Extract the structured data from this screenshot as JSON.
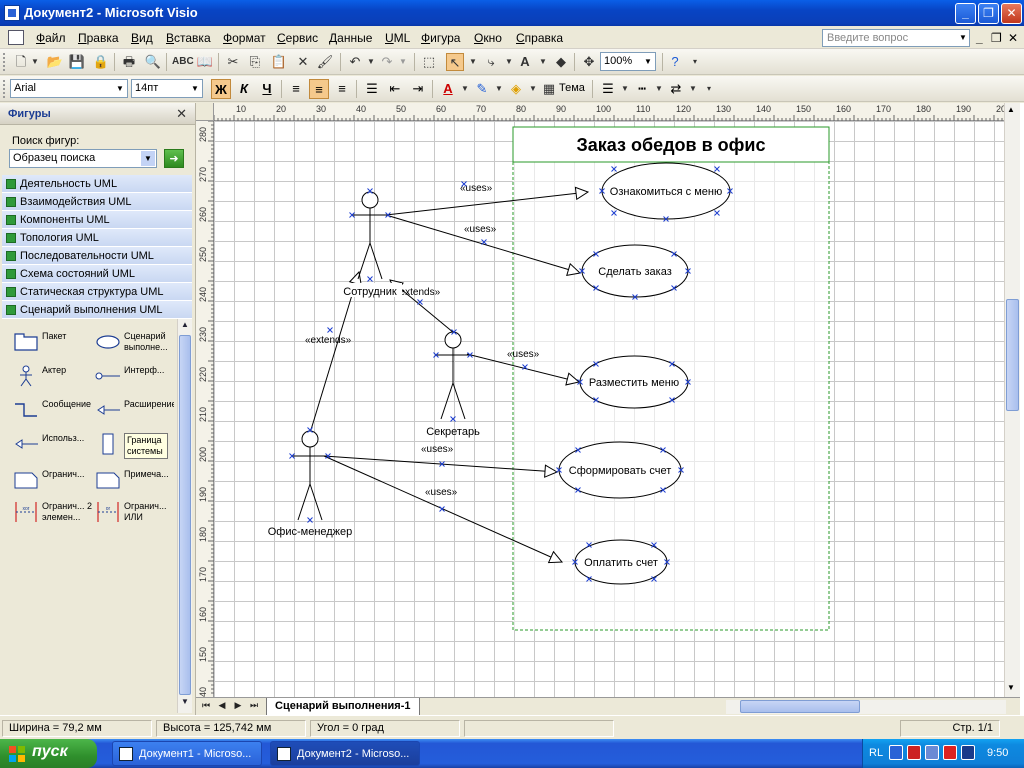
{
  "window": {
    "title": "Документ2 - Microsoft Visio",
    "minimize": "_",
    "maximize": "❐",
    "close": "✕"
  },
  "menu": {
    "items": [
      "Файл",
      "Правка",
      "Вид",
      "Вставка",
      "Формат",
      "Сервис",
      "Данные",
      "UML",
      "Фигура",
      "Окно",
      "Справка"
    ],
    "help_placeholder": "Введите вопрос",
    "mdi_minimize": "_",
    "mdi_restore": "❐",
    "mdi_close": "✕"
  },
  "standard_toolbar": {
    "zoom": "100%"
  },
  "format_toolbar": {
    "font": "Arial",
    "size": "14пт",
    "bold": "Ж",
    "italic": "К",
    "underline": "Ч",
    "theme": "Тема"
  },
  "shapes_pane": {
    "title": "Фигуры",
    "close": "✕",
    "search_label": "Поиск фигур:",
    "search_placeholder": "Образец поиска",
    "search_go": "➜",
    "stencils": [
      "Деятельность UML",
      "Взаимодействия UML",
      "Компоненты UML",
      "Топология UML",
      "Последовательности UML",
      "Схема состояний UML",
      "Статическая структура UML",
      "Сценарий выполнения UML"
    ],
    "masters": [
      {
        "label": "Пакет",
        "icon": "package-icon"
      },
      {
        "label": "Сценарий выполне...",
        "icon": "use-case-icon"
      },
      {
        "label": "Актер",
        "icon": "actor-icon"
      },
      {
        "label": "Интерф...",
        "icon": "interface-icon"
      },
      {
        "label": "Сообщение",
        "icon": "message-icon"
      },
      {
        "label": "Расширение",
        "icon": "extends-icon"
      },
      {
        "label": "Использ...",
        "icon": "uses-icon"
      },
      {
        "label": "Граница системы",
        "icon": "system-boundary-icon"
      },
      {
        "label": "Огранич...",
        "icon": "constraint-icon"
      },
      {
        "label": "Примеча...",
        "icon": "note-icon"
      },
      {
        "label": "Огранич... 2 элемен...",
        "icon": "constraint-2-icon"
      },
      {
        "label": "Огранич... ИЛИ",
        "icon": "constraint-or-icon"
      }
    ]
  },
  "ruler": {
    "top": [
      "10",
      "20",
      "30",
      "40",
      "50",
      "60",
      "70",
      "80",
      "90",
      "100",
      "110",
      "120",
      "130",
      "140",
      "150",
      "160",
      "170",
      "180",
      "190",
      "200"
    ],
    "left": [
      "280",
      "270",
      "260",
      "250",
      "240",
      "230",
      "220",
      "210",
      "200",
      "190",
      "180",
      "170",
      "160",
      "150",
      "140"
    ]
  },
  "diagram": {
    "title": "Заказ обедов в офис",
    "actors": [
      {
        "id": "employee",
        "label": "Сотрудник"
      },
      {
        "id": "secretary",
        "label": "Секретарь"
      },
      {
        "id": "manager",
        "label": "Офис-менеджер"
      }
    ],
    "use_cases": [
      {
        "id": "uc1",
        "label": "Ознакомиться с меню"
      },
      {
        "id": "uc2",
        "label": "Сделать заказ"
      },
      {
        "id": "uc3",
        "label": "Разместить меню"
      },
      {
        "id": "uc4",
        "label": "Сформировать счет"
      },
      {
        "id": "uc5",
        "label": "Оплатить счет"
      }
    ],
    "relations": [
      {
        "label": "«uses»"
      },
      {
        "label": "«uses»"
      },
      {
        "label": "«uses»"
      },
      {
        "label": "«uses»"
      },
      {
        "label": "«uses»"
      },
      {
        "label": "«extends»"
      },
      {
        "label": "«extends»"
      }
    ]
  },
  "page_tab": "Сценарий выполнения-1",
  "status": {
    "width": "Ширина = 79,2 мм",
    "height": "Высота = 125,742 мм",
    "angle": "Угол = 0 град",
    "page": "Стр. 1/1"
  },
  "taskbar": {
    "start": "пуск",
    "tasks": [
      "Документ1 - Microso...",
      "Документ2 - Microso..."
    ],
    "lang": "RL",
    "clock": "9:50"
  }
}
